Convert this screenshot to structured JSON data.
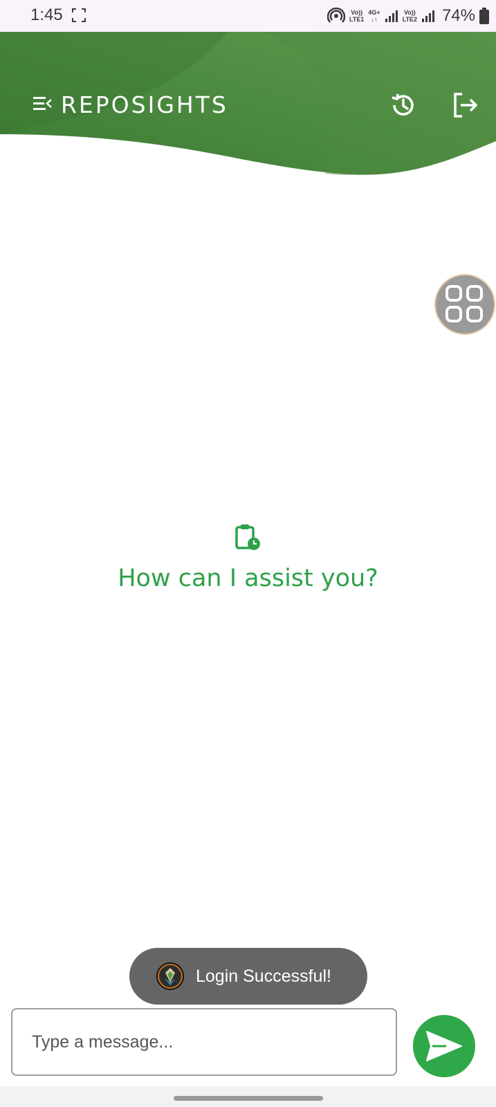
{
  "status_bar": {
    "time": "1:45",
    "sim1_label_top": "Vo))",
    "sim1_label_bottom": "LTE1",
    "network_type": "4G+",
    "sim2_label_top": "Vo))",
    "sim2_label_bottom": "LTE2",
    "battery": "74%"
  },
  "header": {
    "title": "REPOSIGHTS",
    "icons": [
      "menu-icon",
      "history-icon",
      "logout-icon"
    ]
  },
  "main": {
    "empty_state_icon": "clipboard-clock-icon",
    "prompt": "How can I assist you?"
  },
  "toast": {
    "message": "Login Successful!"
  },
  "composer": {
    "placeholder": "Type a message..."
  },
  "colors": {
    "accent_green": "#2fa84a",
    "header_dark": "#3b7a33",
    "header_light": "#5e9b4e"
  }
}
